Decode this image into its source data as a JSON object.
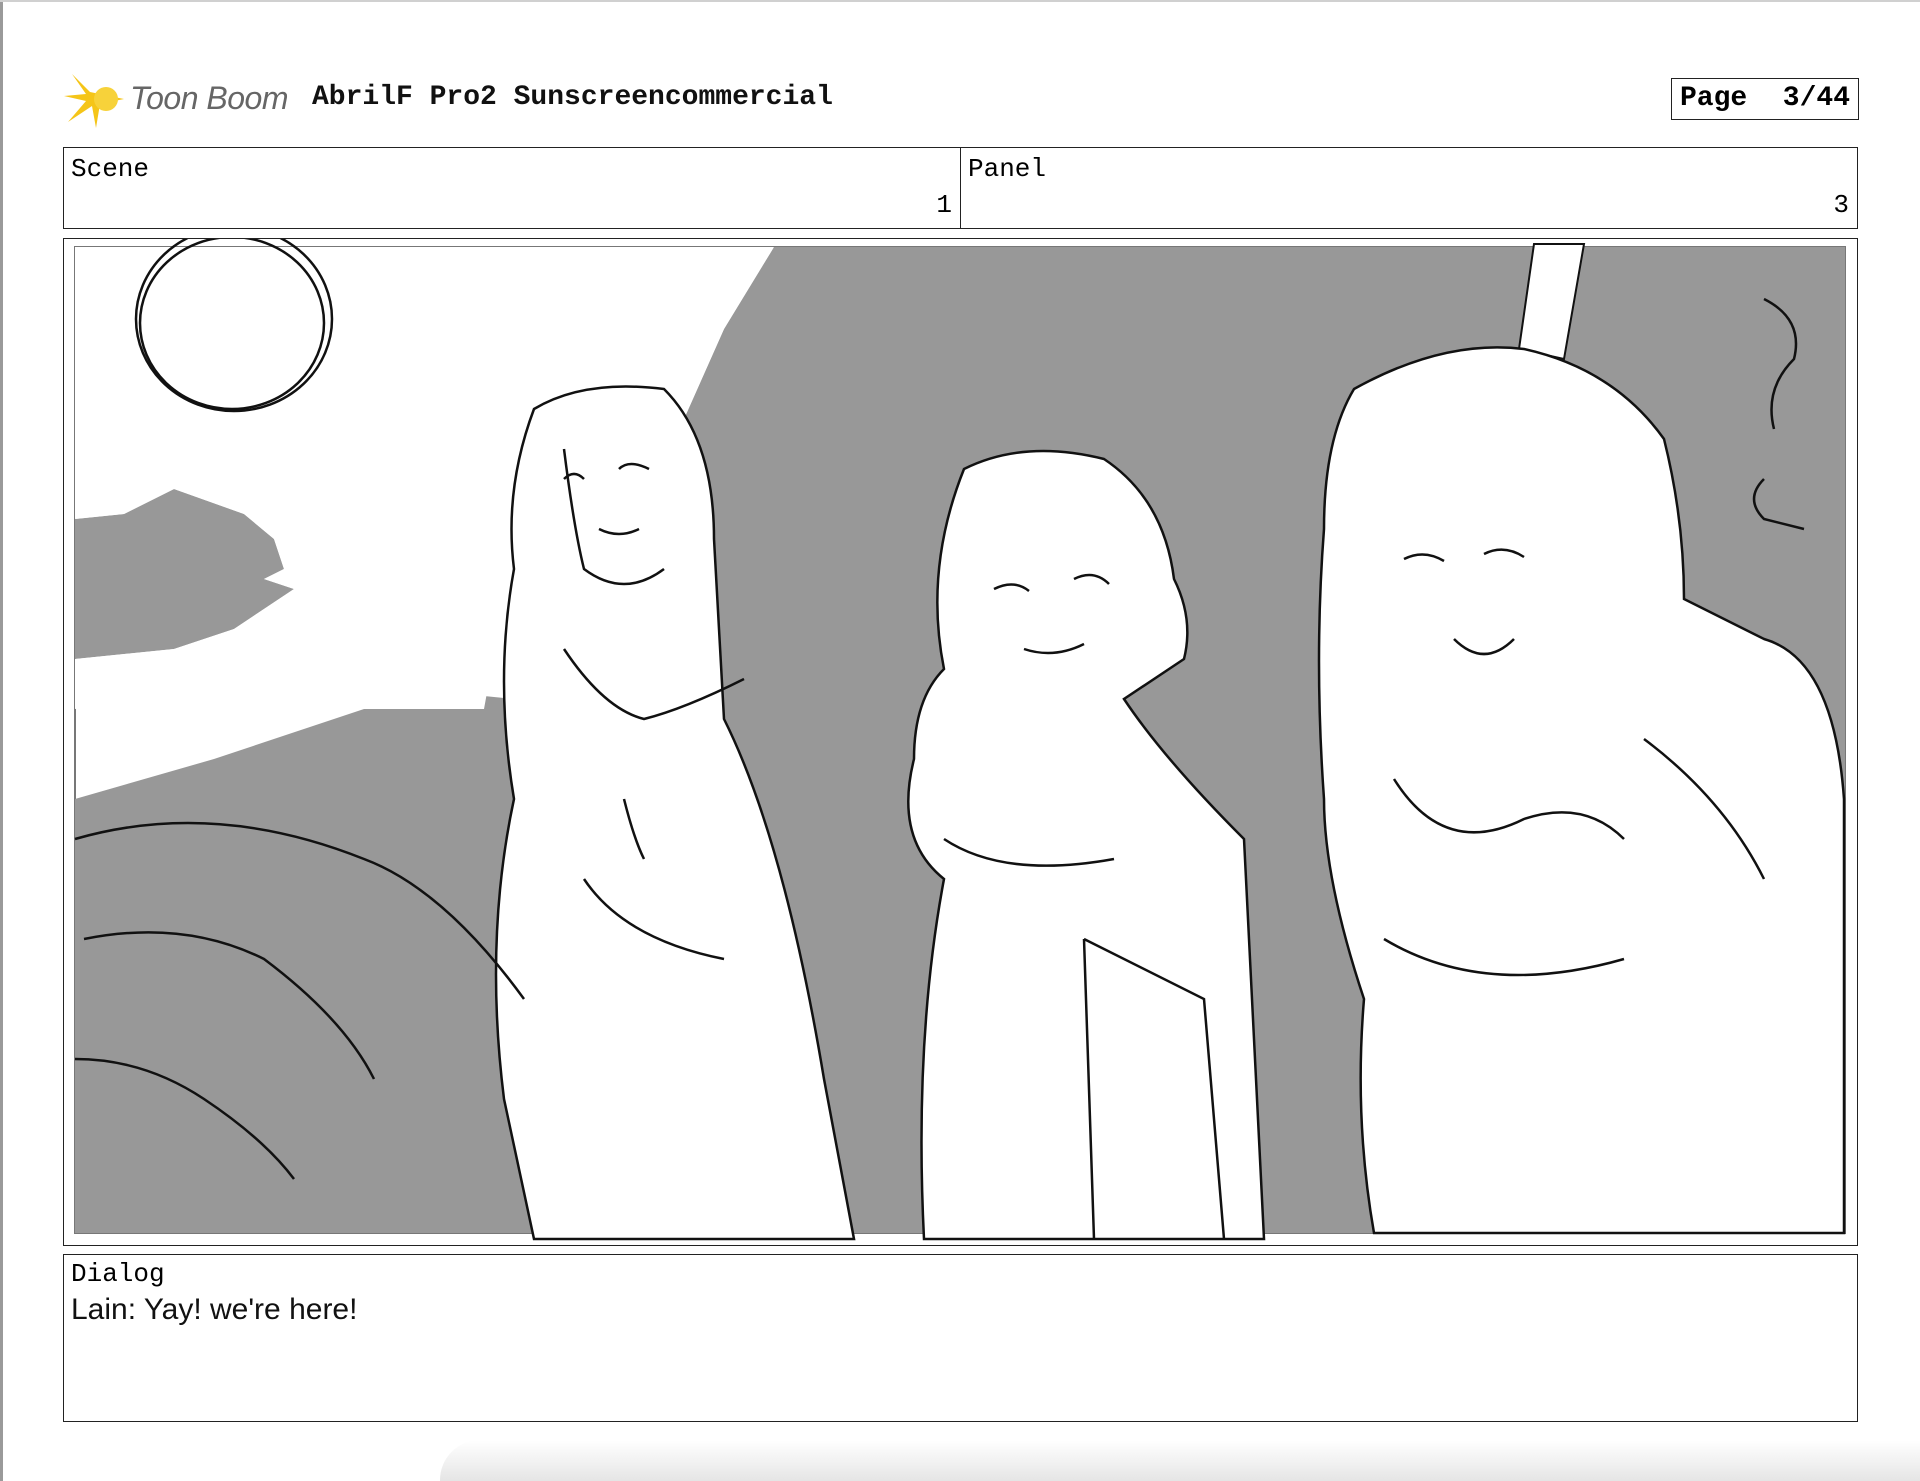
{
  "header": {
    "logo_text": "Toon Boom",
    "project_title": "AbrilF Pro2 Sunscreencommercial",
    "page_label": "Page",
    "page_number": "3/44"
  },
  "scene": {
    "label": "Scene",
    "value": "1"
  },
  "panel": {
    "label": "Panel",
    "value": "3"
  },
  "dialog": {
    "label": "Dialog",
    "text": "Lain: Yay! we're here!"
  },
  "colors": {
    "sketch_gray": "#989898",
    "ink": "#111111",
    "logo_yellow": "#f5c518"
  }
}
